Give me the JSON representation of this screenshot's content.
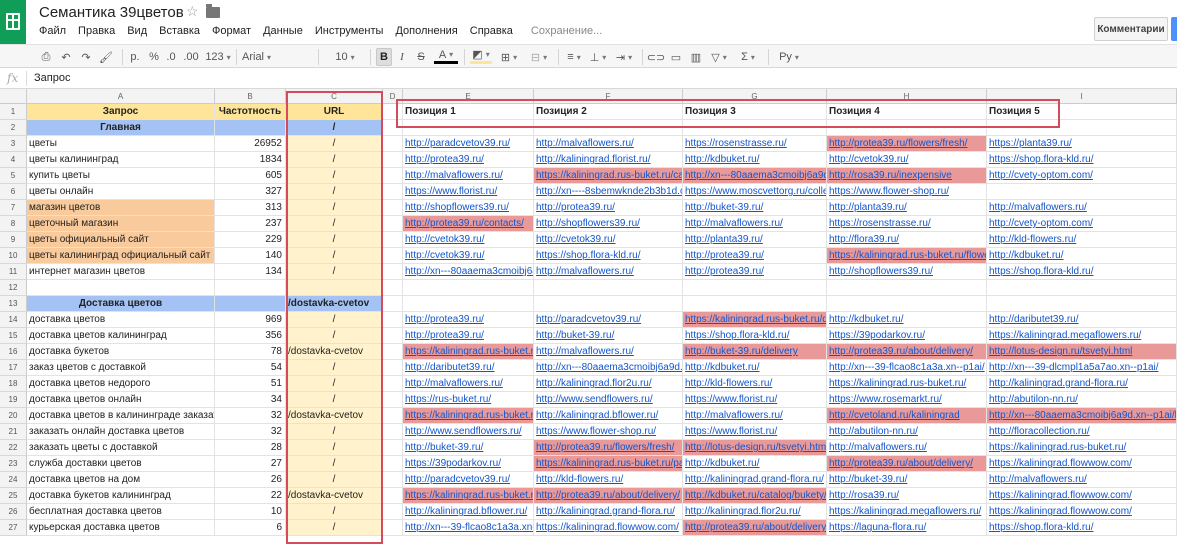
{
  "app": {
    "title": "Семантика 39цветов",
    "save_status": "Сохранение...",
    "comments_label": "Комментарии",
    "menus": [
      "Файл",
      "Правка",
      "Вид",
      "Вставка",
      "Формат",
      "Данные",
      "Инструменты",
      "Дополнения",
      "Справка"
    ]
  },
  "toolbar": {
    "items": [
      {
        "name": "print-icon",
        "label": "⎙"
      },
      {
        "name": "undo-icon",
        "label": "↶"
      },
      {
        "name": "redo-icon",
        "label": "↷"
      },
      {
        "name": "paint-format-icon",
        "label": "🖌"
      },
      {
        "name": "currency-format-button",
        "label": "р."
      },
      {
        "name": "percent-format-button",
        "label": "%"
      },
      {
        "name": "decrease-decimal-button",
        "label": ".0"
      },
      {
        "name": "increase-decimal-button",
        "label": ".00"
      },
      {
        "name": "more-formats-button",
        "label": "123"
      }
    ],
    "font": "Arial",
    "font_size": "10",
    "bold_label": "B",
    "text_direction_label": "Ру"
  },
  "formula_bar": {
    "fx_label": "fx",
    "value": "Запрос"
  },
  "sheet": {
    "column_headers": [
      "A",
      "B",
      "C",
      "D",
      "E",
      "F",
      "G",
      "H",
      "I"
    ],
    "row_numbers": [
      "1",
      "2",
      "3",
      "4",
      "5",
      "6",
      "7",
      "8",
      "9",
      "10",
      "11",
      "12",
      "13",
      "14",
      "15",
      "16",
      "17",
      "18",
      "19",
      "20",
      "21",
      "22",
      "23",
      "24",
      "25",
      "26",
      "27"
    ],
    "headers": {
      "query": "Запрос",
      "frequency": "Частотность",
      "url": "URL",
      "positions": [
        "Позиция 1",
        "Позиция 2",
        "Позиция 3",
        "Позиция 4",
        "Позиция 5"
      ]
    },
    "rows": [
      {
        "a": "Главная",
        "b": "",
        "c": "/",
        "a_style": "section",
        "c_style": "section"
      },
      {
        "a": "цветы",
        "b": "26952",
        "c": "/",
        "e": "http://paradcvetov39.ru/",
        "f": "http://malvaflowers.ru/",
        "g": "https://rosenstrasse.ru/",
        "h": "http://protea39.ru/flowers/fresh/",
        "i": "https://planta39.ru/",
        "hl": [
          "h"
        ]
      },
      {
        "a": "цветы калининград",
        "b": "1834",
        "c": "/",
        "e": "http://protea39.ru/",
        "f": "http://kaliningrad.florist.ru/",
        "g": "http://kdbuket.ru/",
        "h": "http://cvetok39.ru/",
        "i": "https://shop.flora-kld.ru/"
      },
      {
        "a": "купить цветы",
        "b": "605",
        "c": "/",
        "e": "http://malvaflowers.ru/",
        "f": "https://kaliningrad.rus-buket.ru/cat",
        "g": "http://xn---80aaema3cmoibj6a9d.x",
        "h": "http://rosa39.ru/inexpensive",
        "i": "http://cvety-optom.com/",
        "hl": [
          "f",
          "g",
          "h"
        ]
      },
      {
        "a": "цветы онлайн",
        "b": "327",
        "c": "/",
        "e": "https://www.florist.ru/",
        "f": "http://xn----8sbemwknde2b3b1d.c",
        "g": "https://www.moscvettorg.ru/colle",
        "h": "https://www.flower-shop.ru/",
        "i": ""
      },
      {
        "a": "магазин цветов",
        "b": "313",
        "c": "/",
        "e": "http://shopflowers39.ru/",
        "f": "http://protea39.ru/",
        "g": "http://buket-39.ru/",
        "h": "http://planta39.ru/",
        "i": "http://malvaflowers.ru/",
        "a_style": "orange"
      },
      {
        "a": "цветочный магазин",
        "b": "237",
        "c": "/",
        "e": "http://protea39.ru/contacts/",
        "f": "http://shopflowers39.ru/",
        "g": "http://malvaflowers.ru/",
        "h": "https://rosenstrasse.ru/",
        "i": "http://cvety-optom.com/",
        "a_style": "orange",
        "hl": [
          "e"
        ]
      },
      {
        "a": "цветы официальный сайт",
        "b": "229",
        "c": "/",
        "e": "http://cvetok39.ru/",
        "f": "http://cvetok39.ru/",
        "g": "http://planta39.ru/",
        "h": "http://flora39.ru/",
        "i": "http://kld-flowers.ru/",
        "a_style": "orange"
      },
      {
        "a": "цветы калининград официальный сайт",
        "b": "140",
        "c": "/",
        "e": "http://cvetok39.ru/",
        "f": "https://shop.flora-kld.ru/",
        "g": "http://protea39.ru/",
        "h": "https://kaliningrad.rus-buket.ru/flowe",
        "i": "http://kdbuket.ru/",
        "a_style": "orange",
        "hl": [
          "h"
        ]
      },
      {
        "a": "интернет магазин цветов",
        "b": "134",
        "c": "/",
        "e": "http://xn---80aaema3cmoibj6a",
        "f": "http://malvaflowers.ru/",
        "g": "http://protea39.ru/",
        "h": "http://shopflowers39.ru/",
        "i": "https://shop.flora-kld.ru/"
      },
      {
        "a": "",
        "b": "",
        "c": ""
      },
      {
        "a": "Доставка цветов",
        "b": "",
        "c": "/dostavka-cvetov",
        "a_style": "section",
        "c_style": "section"
      },
      {
        "a": "доставка цветов",
        "b": "969",
        "c": "/",
        "e": "http://protea39.ru/",
        "f": "http://paradcvetov39.ru/",
        "g": "https://kaliningrad.rus-buket.ru/d",
        "h": "http://kdbuket.ru/",
        "i": "http://daributet39.ru/",
        "hl": [
          "g"
        ]
      },
      {
        "a": "доставка цветов калининград",
        "b": "356",
        "c": "/",
        "e": "http://protea39.ru/",
        "f": "http://buket-39.ru/",
        "g": "https://shop.flora-kld.ru/",
        "h": "https://39podarkov.ru/",
        "i": "https://kaliningrad.megaflowers.ru/"
      },
      {
        "a": "доставка букетов",
        "b": "78",
        "c": "/dostavka-cvetov",
        "e": "https://kaliningrad.rus-buket.r",
        "f": "http://malvaflowers.ru/",
        "g": "http://buket-39.ru/delivery",
        "h": "http://protea39.ru/about/delivery/",
        "i": "http://lotus-design.ru/tsvetyi.html",
        "hl": [
          "e",
          "g",
          "h",
          "i"
        ]
      },
      {
        "a": "заказ цветов с доставкой",
        "b": "54",
        "c": "/",
        "e": "http://daributet39.ru/",
        "f": "http://xn---80aaema3cmoibj6a9d.x",
        "g": "http://kdbuket.ru/",
        "h": "http://xn---39-flcao8c1a3a.xn--p1ai/",
        "i": "http://xn---39-dlcmpl1a5a7ao.xn--p1ai/"
      },
      {
        "a": "доставка цветов недорого",
        "b": "51",
        "c": "/",
        "e": "http://malvaflowers.ru/",
        "f": "http://kaliningrad.flor2u.ru/",
        "g": "http://kld-flowers.ru/",
        "h": "https://kaliningrad.rus-buket.ru/",
        "i": "http://kaliningrad.grand-flora.ru/"
      },
      {
        "a": "доставка цветов онлайн",
        "b": "34",
        "c": "/",
        "e": "https://rus-buket.ru/",
        "f": "http://www.sendflowers.ru/",
        "g": "https://www.florist.ru/",
        "h": "https://www.rosemarkt.ru/",
        "i": "http://abutilon-nn.ru/"
      },
      {
        "a": "доставка цветов в калининграде заказать",
        "b": "32",
        "c": "/dostavka-cvetov",
        "e": "https://kaliningrad.rus-buket.r",
        "f": "http://kaliningrad.bflower.ru/",
        "g": "http://malvaflowers.ru/",
        "h": "http://cvetoland.ru/kaliningrad",
        "i": "http://xn---80aaema3cmoibj6a9d.xn--p1ai/kaliningrad/",
        "hl": [
          "e",
          "h",
          "i"
        ]
      },
      {
        "a": "заказать онлайн доставка цветов",
        "b": "32",
        "c": "/",
        "e": "http://www.sendflowers.ru/",
        "f": "https://www.flower-shop.ru/",
        "g": "https://www.florist.ru/",
        "h": "http://abutilon-nn.ru/",
        "i": "http://floracollection.ru/"
      },
      {
        "a": "заказать цветы с доставкой",
        "b": "28",
        "c": "/",
        "e": "http://buket-39.ru/",
        "f": "http://protea39.ru/flowers/fresh/",
        "g": "http://lotus-design.ru/tsvetyi.html",
        "h": "http://malvaflowers.ru/",
        "i": "https://kaliningrad.rus-buket.ru/",
        "hl": [
          "f",
          "g"
        ]
      },
      {
        "a": "служба доставки цветов",
        "b": "27",
        "c": "/",
        "e": "https://39podarkov.ru/",
        "f": "https://kaliningrad.rus-buket.ru/pa",
        "g": "http://kdbuket.ru/",
        "h": "http://protea39.ru/about/delivery/",
        "i": "https://kaliningrad.flowwow.com/",
        "hl": [
          "f",
          "h"
        ]
      },
      {
        "a": "доставка цветов на дом",
        "b": "26",
        "c": "/",
        "e": "http://paradcvetov39.ru/",
        "f": "http://kld-flowers.ru/",
        "g": "http://kaliningrad.grand-flora.ru/",
        "h": "http://buket-39.ru/",
        "i": "http://malvaflowers.ru/"
      },
      {
        "a": "доставка букетов калининград",
        "b": "22",
        "c": "/dostavka-cvetov",
        "e": "https://kaliningrad.rus-buket.r",
        "f": "http://protea39.ru/about/delivery/",
        "g": "http://kdbuket.ru/catalog/bukety/",
        "h": "http://rosa39.ru/",
        "i": "https://kaliningrad.flowwow.com/",
        "hl": [
          "e",
          "f",
          "g"
        ]
      },
      {
        "a": "бесплатная доставка цветов",
        "b": "10",
        "c": "/",
        "e": "http://kaliningrad.bflower.ru/",
        "f": "http://kaliningrad.grand-flora.ru/",
        "g": "http://kaliningrad.flor2u.ru/",
        "h": "https://kaliningrad.megaflowers.ru/",
        "i": "https://kaliningrad.flowwow.com/"
      },
      {
        "a": "курьерская доставка цветов",
        "b": "6",
        "c": "/",
        "e": "http://xn---39-flcao8c1a3a.xn--",
        "f": "https://kaliningrad.flowwow.com/",
        "g": "http://protea39.ru/about/delivery/",
        "h": "https://laguna-flora.ru/",
        "i": "https://shop.flora-kld.ru/",
        "hl": [
          "g"
        ]
      }
    ]
  }
}
